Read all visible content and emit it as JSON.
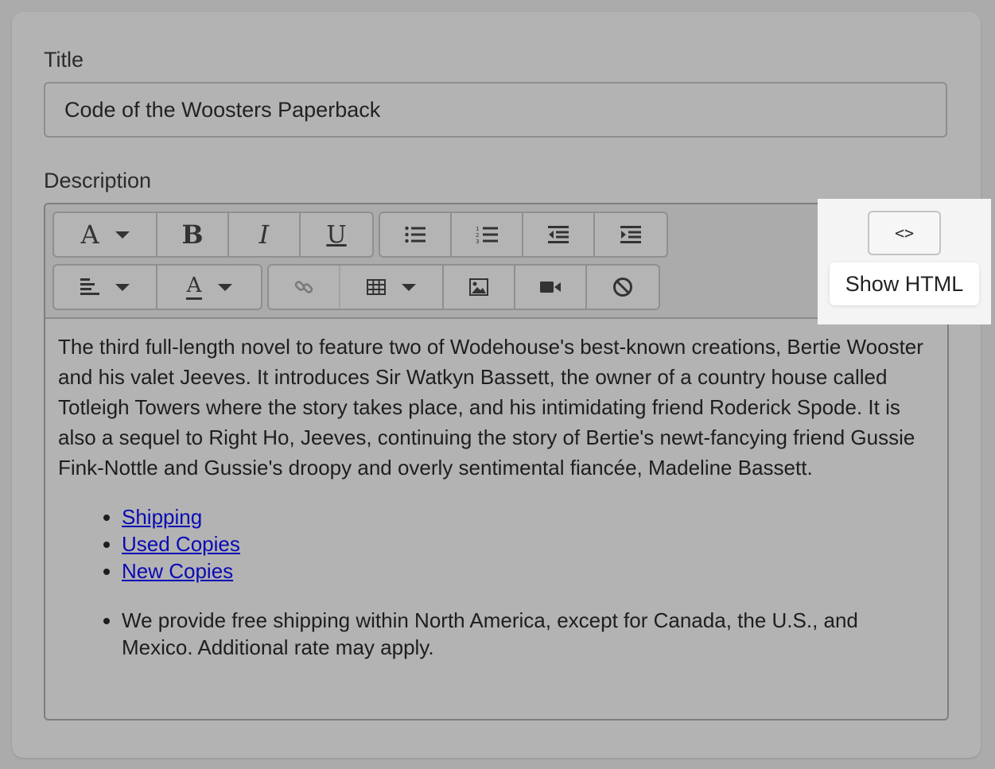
{
  "form": {
    "title_label": "Title",
    "title_value": "Code of the Woosters Paperback",
    "description_label": "Description"
  },
  "toolbar": {
    "row1": [
      {
        "name": "font-style",
        "glyph": "A",
        "icon": "font-style-icon",
        "dropdown": true
      },
      {
        "name": "bold",
        "glyph": "B",
        "icon": "bold-icon"
      },
      {
        "name": "italic",
        "glyph": "I",
        "icon": "italic-icon"
      },
      {
        "name": "underline",
        "glyph": "U",
        "icon": "underline-icon"
      },
      {
        "name": "bulleted-list",
        "icon": "bulleted-list-icon"
      },
      {
        "name": "numbered-list",
        "icon": "numbered-list-icon"
      },
      {
        "name": "outdent",
        "icon": "outdent-icon"
      },
      {
        "name": "indent",
        "icon": "indent-icon"
      }
    ],
    "row2": [
      {
        "name": "align",
        "icon": "align-left-icon",
        "dropdown": true
      },
      {
        "name": "text-color",
        "glyph": "A",
        "icon": "text-color-icon",
        "dropdown": true
      },
      {
        "name": "link",
        "icon": "link-icon",
        "disabled": true
      },
      {
        "name": "table",
        "icon": "table-icon",
        "dropdown": true
      },
      {
        "name": "image",
        "icon": "image-icon"
      },
      {
        "name": "video",
        "icon": "video-icon"
      },
      {
        "name": "clear-formatting",
        "icon": "clear-formatting-icon"
      }
    ],
    "html_button_label": "<>",
    "tooltip": "Show HTML"
  },
  "content": {
    "paragraph": "The third full-length novel to feature two of Wodehouse's best-known creations, Bertie Wooster and his valet Jeeves. It introduces Sir Watkyn Bassett, the owner of a country house called Totleigh Towers where the story takes place, and his intimidating friend Roderick Spode. It is also a sequel to Right Ho, Jeeves, continuing the story of Bertie's newt-fancying friend Gussie Fink-Nottle and Gussie's droopy and overly sentimental fiancée, Madeline Bassett.",
    "links": [
      "Shipping",
      "Used Copies",
      "New Copies"
    ],
    "shipping_note": "We provide free shipping within North America, except for Canada, the U.S., and Mexico. Additional rate may apply."
  }
}
